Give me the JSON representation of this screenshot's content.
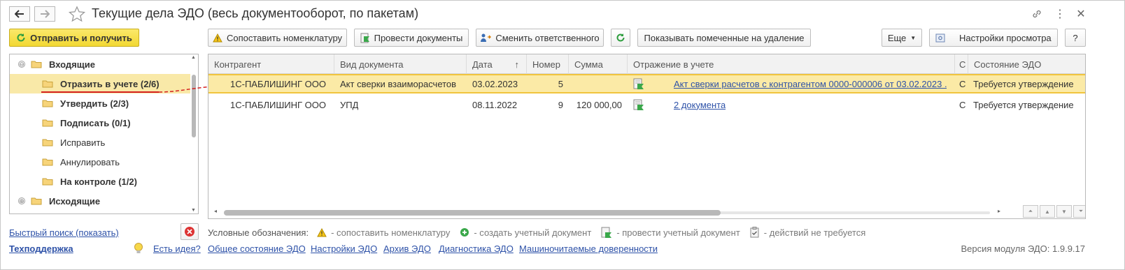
{
  "window": {
    "title": "Текущие дела ЭДО (весь документооборот, по пакетам)"
  },
  "toolbar": {
    "send_receive": "Отправить и получить",
    "match_nomenclature": "Сопоставить номенклатуру",
    "post_documents": "Провести документы",
    "change_responsible": "Сменить ответственного",
    "show_deleted": "Показывать помеченные на удаление",
    "more": "Еще",
    "view_settings": "Настройки просмотра",
    "help": "?"
  },
  "tree": {
    "items": [
      {
        "label": "Входящие",
        "expander": "⊖"
      },
      {
        "label": "Отразить в учете (2/6)"
      },
      {
        "label": "Утвердить (2/3)"
      },
      {
        "label": "Подписать (0/1)"
      },
      {
        "label": "Исправить"
      },
      {
        "label": "Аннулировать"
      },
      {
        "label": "На контроле (1/2)"
      },
      {
        "label": "Исходящие",
        "expander": "⊕"
      }
    ]
  },
  "quick_search": "Быстрый поиск (показать)",
  "table": {
    "columns": [
      "Контрагент",
      "Вид документа",
      "Дата",
      "Номер",
      "Сумма",
      "Отражение в учете",
      "С",
      "Состояние ЭДО"
    ],
    "sort_indicator": "↑",
    "rows": [
      {
        "counterparty": "1С-ПАБЛИШИНГ ООО",
        "doc_type": "Акт сверки взаиморасчетов",
        "date": "03.02.2023",
        "number": "5",
        "sum": "",
        "reflection": "Акт сверки расчетов с контрагентом 0000-000006 от 03.02.2023 ...",
        "c": "С",
        "state": "Требуется утверждение"
      },
      {
        "counterparty": "1С-ПАБЛИШИНГ ООО",
        "doc_type": "УПД",
        "date": "08.11.2022",
        "number": "9",
        "sum": "120 000,00",
        "reflection": "2 документа",
        "c": "С",
        "state": "Требуется утверждение"
      }
    ]
  },
  "legend": {
    "title": "Условные обозначения:",
    "items": [
      {
        "text": "- сопоставить номенклатуру",
        "icon": "warning-icon"
      },
      {
        "text": "- создать учетный документ",
        "icon": "plus-circle-icon"
      },
      {
        "text": "- провести учетный документ",
        "icon": "post-doc-icon"
      },
      {
        "text": "- действий не требуется",
        "icon": "checklist-icon"
      }
    ]
  },
  "footer": {
    "support": "Техподдержка",
    "idea": "Есть идея?",
    "links": [
      "Общее состояние ЭДО",
      "Настройки ЭДО",
      "Архив ЭДО",
      "Диагностика ЭДО",
      "Машиночитаемые доверенности"
    ],
    "version": "Версия модуля ЭДО: 1.9.9.17"
  },
  "colors": {
    "accent_yellow": "#f2d833",
    "selection": "#fbeaa6",
    "link": "#2e52a8",
    "annotation_red": "#d42020",
    "refresh_green": "#2e9e3e"
  }
}
